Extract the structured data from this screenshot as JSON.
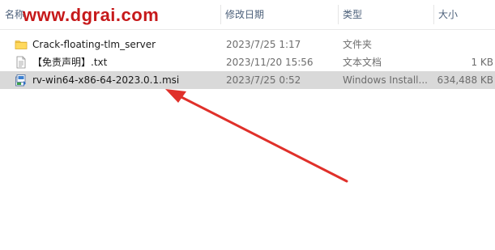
{
  "watermark": "www.dgrai.com",
  "columns": {
    "name": "名称",
    "date": "修改日期",
    "type": "类型",
    "size": "大小"
  },
  "files": [
    {
      "name": "Crack-floating-tlm_server",
      "date": "2023/7/25 1:17",
      "type": "文件夹",
      "size": "",
      "icon": "folder-icon",
      "selected": false
    },
    {
      "name": "【免责声明】.txt",
      "date": "2023/11/20 15:56",
      "type": "文本文档",
      "size": "1 KB",
      "icon": "text-file-icon",
      "selected": false
    },
    {
      "name": "rv-win64-x86-64-2023.0.1.msi",
      "date": "2023/7/25 0:52",
      "type": "Windows Install...",
      "size": "634,488 KB",
      "icon": "msi-installer-icon",
      "selected": true
    }
  ],
  "colors": {
    "watermark": "#c6191a",
    "arrow": "#e0302a",
    "selected_row": "#d9d9d9",
    "header_text": "#4c607a"
  }
}
